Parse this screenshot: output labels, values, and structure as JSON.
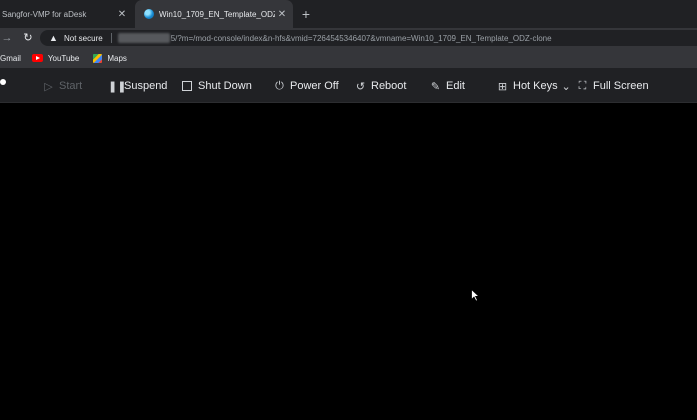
{
  "tabs": [
    {
      "title": "Sangfor-VMP for aDesk",
      "active": false
    },
    {
      "title": "Win10_1709_EN_Template_ODZ-",
      "active": true
    }
  ],
  "new_tab_symbol": "+",
  "address_bar": {
    "security_label": "Not secure",
    "url_visible": "5/?m=/mod-console/index&n-hfs&vmid=7264545346407&vmname=Win10_1709_EN_Template_ODZ-clone"
  },
  "bookmarks": [
    {
      "label": "Gmail",
      "icon": "gmail-icon"
    },
    {
      "label": "YouTube",
      "icon": "youtube-icon"
    },
    {
      "label": "Maps",
      "icon": "maps-icon"
    }
  ],
  "console_toolbar": {
    "start": "Start",
    "suspend": "Suspend",
    "shut_down": "Shut Down",
    "power_off": "Power Off",
    "reboot": "Reboot",
    "edit": "Edit",
    "hot_keys": "Hot Keys",
    "full_screen": "Full Screen"
  },
  "colors": {
    "tab_strip": "#202124",
    "toolbar": "#35363a",
    "console_background": "#000000",
    "text": "#e8eaed",
    "disabled_text": "#5f6368"
  }
}
